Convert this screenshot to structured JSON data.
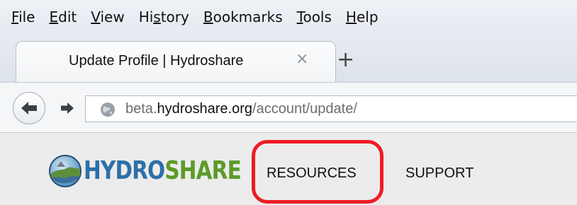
{
  "menubar": {
    "items": [
      {
        "accel": "F",
        "rest": "ile"
      },
      {
        "accel": "E",
        "rest": "dit"
      },
      {
        "accel": "V",
        "rest": "iew"
      },
      {
        "pre": "Hi",
        "accel": "s",
        "rest": "tory"
      },
      {
        "accel": "B",
        "rest": "ookmarks"
      },
      {
        "accel": "T",
        "rest": "ools"
      },
      {
        "accel": "H",
        "rest": "elp"
      }
    ]
  },
  "tabs": {
    "active_title": "Update Profile | Hydroshare",
    "close_glyph": "×",
    "new_tab_glyph": "+"
  },
  "navbar": {
    "url_domain_prefix": "beta.",
    "url_domain": "hydroshare.org",
    "url_path": "/account/update/"
  },
  "site": {
    "logo_hydro": "HYDRO",
    "logo_share": "SHARE",
    "nav": {
      "resources": "RESOURCES",
      "support": "SUPPORT"
    },
    "colors": {
      "hydro": "#2e6fa8",
      "share": "#5c9b2a",
      "highlight": "#ee1c24"
    }
  }
}
